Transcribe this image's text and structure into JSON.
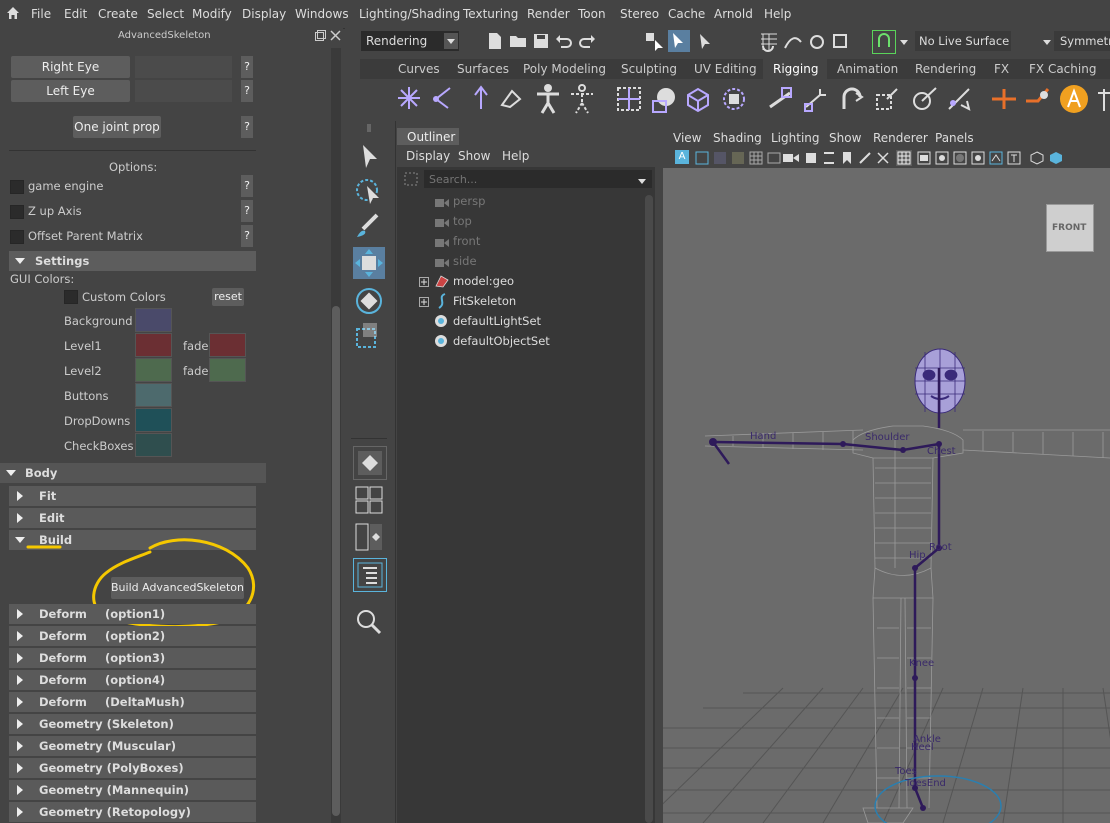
{
  "menu": [
    "File",
    "Edit",
    "Create",
    "Select",
    "Modify",
    "Display",
    "Windows",
    "Lighting/Shading",
    "Texturing",
    "Render",
    "Toon",
    "Stereo",
    "Cache",
    "Arnold",
    "Help"
  ],
  "status_line": {
    "mode": "Rendering",
    "live_surface": "No Live Surface",
    "symmetry": "Symmetry"
  },
  "panel": {
    "title": "AdvancedSkeleton",
    "right_eye": "Right Eye",
    "left_eye": "Left Eye",
    "one_joint_prop": "One joint prop",
    "q": "?",
    "options_label": "Options:",
    "game_engine": "game engine",
    "z_up": "Z up Axis",
    "offset_parent": "Offset Parent Matrix",
    "settings": "Settings",
    "gui_colors": "GUI Colors:",
    "custom_colors": "Custom Colors",
    "reset": "reset",
    "background": "Background",
    "level1": "Level1",
    "level2": "Level2",
    "fade": "fade",
    "buttons": "Buttons",
    "dropdowns": "DropDowns",
    "checkboxes": "CheckBoxes",
    "body": "Body",
    "fit": "Fit",
    "edit": "Edit",
    "build": "Build",
    "build_button": "Build AdvancedSkeleton",
    "deform_items": [
      {
        "a": "Deform",
        "b": "(option1)"
      },
      {
        "a": "Deform",
        "b": "(option2)"
      },
      {
        "a": "Deform",
        "b": "(option3)"
      },
      {
        "a": "Deform",
        "b": "(option4)"
      },
      {
        "a": "Deform",
        "b": "(DeltaMush)"
      }
    ],
    "geometry_items": [
      "Geometry (Skeleton)",
      "Geometry (Muscular)",
      "Geometry (PolyBoxes)",
      "Geometry (Mannequin)",
      "Geometry (Retopology)"
    ],
    "colors": {
      "background": "#4a4a6a",
      "level1": "#6b2f33",
      "level2": "#4e6a4e",
      "fade1": "#6b2f33",
      "fade2": "#4e6a4e",
      "buttons": "#4d6a6d",
      "dropdowns": "#1f5058",
      "checkboxes": "#2f4e4e"
    }
  },
  "shelf_tabs": [
    "Curves",
    "Surfaces",
    "Poly Modeling",
    "Sculpting",
    "UV Editing",
    "Rigging",
    "Animation",
    "Rendering",
    "FX",
    "FX Caching"
  ],
  "active_tab": "Rigging",
  "outliner": {
    "title": "Outliner",
    "menu": [
      "Display",
      "Show",
      "Help"
    ],
    "search_placeholder": "Search...",
    "items": [
      "persp",
      "top",
      "front",
      "side",
      "model:geo",
      "FitSkeleton",
      "defaultLightSet",
      "defaultObjectSet"
    ]
  },
  "viewport": {
    "menu": [
      "View",
      "Shading",
      "Lighting",
      "Show",
      "Renderer",
      "Panels"
    ],
    "cube_label": "FRONT",
    "joint_labels": [
      "Hand",
      "Shoulder",
      "Chest",
      "Root",
      "Hip",
      "Knee",
      "Ankle",
      "Heel",
      "Toes",
      "ToesEnd"
    ]
  },
  "accent_color": "#5ab4dc"
}
